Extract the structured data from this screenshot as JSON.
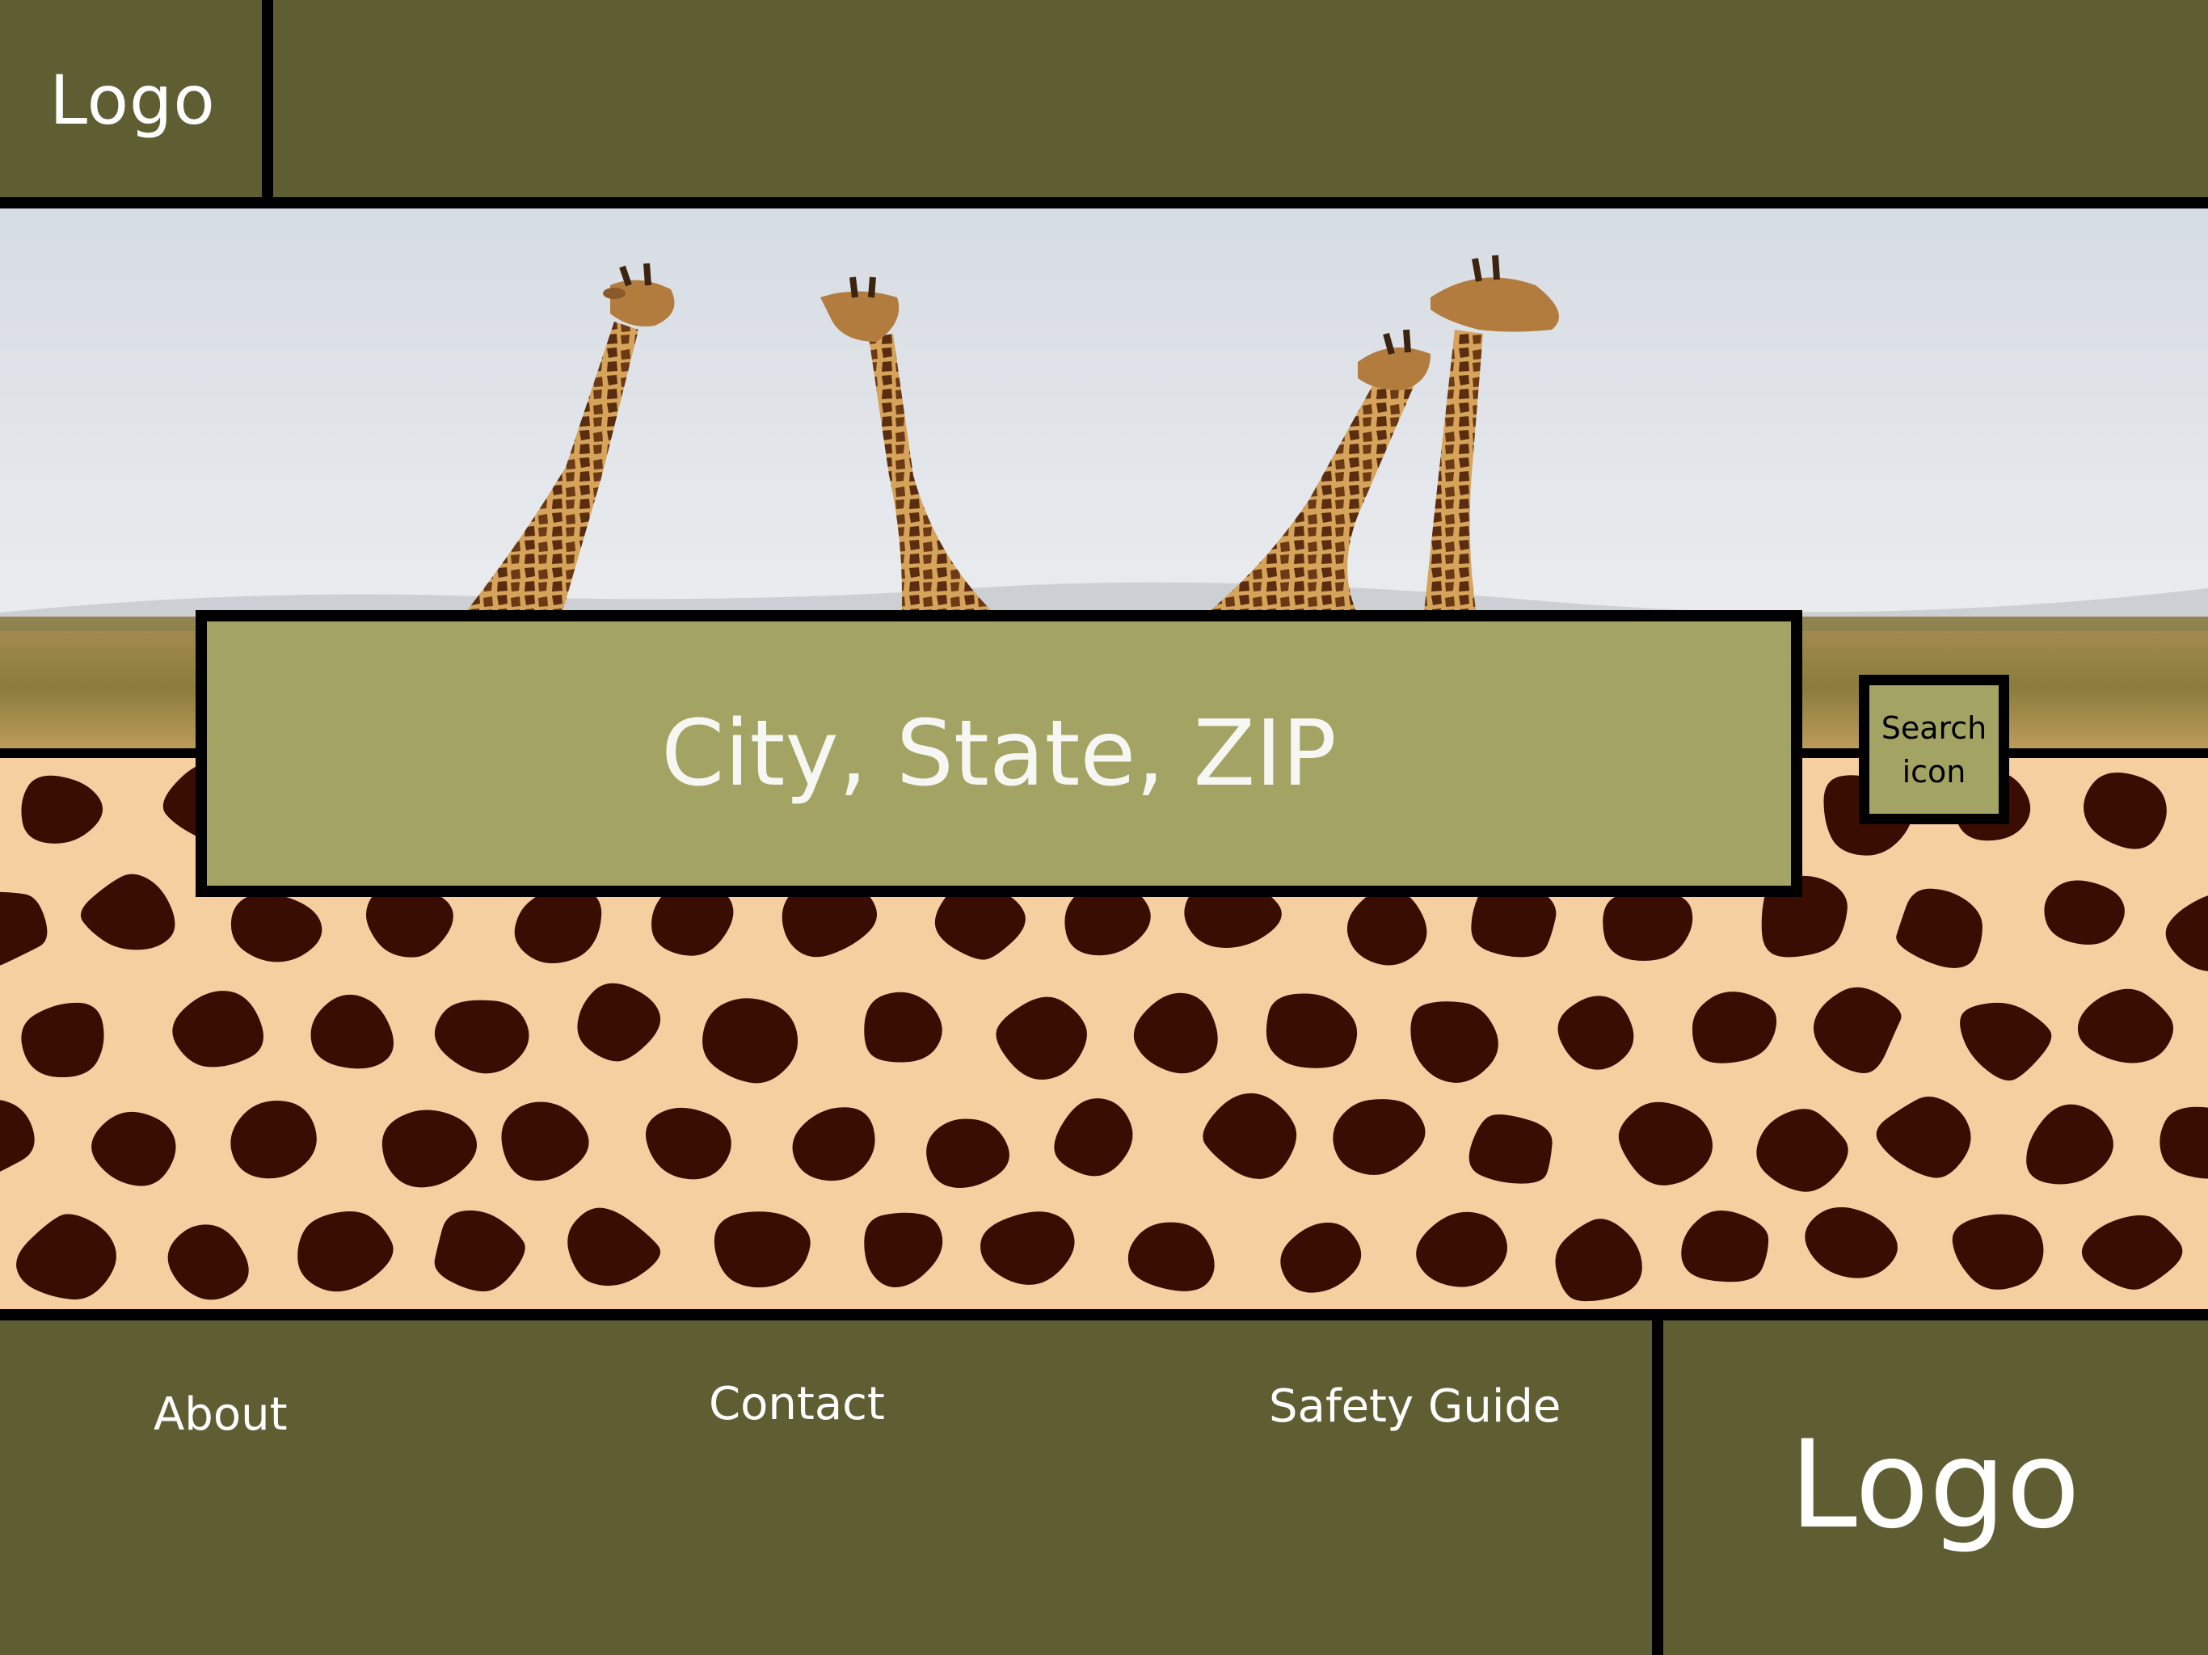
{
  "header": {
    "logo_text": "Logo"
  },
  "search": {
    "placeholder": "City, State, ZIP",
    "button_label": "Search icon"
  },
  "footer": {
    "links": [
      "About",
      "Contact",
      "Safety Guide"
    ],
    "logo_text": "Logo"
  },
  "colors": {
    "olive_dark": "#5f5e33",
    "olive_light": "#a3a463",
    "spot_brown": "#3a0d02",
    "pattern_tan": "#f5cfa0"
  },
  "icons": [
    "search-icon"
  ]
}
